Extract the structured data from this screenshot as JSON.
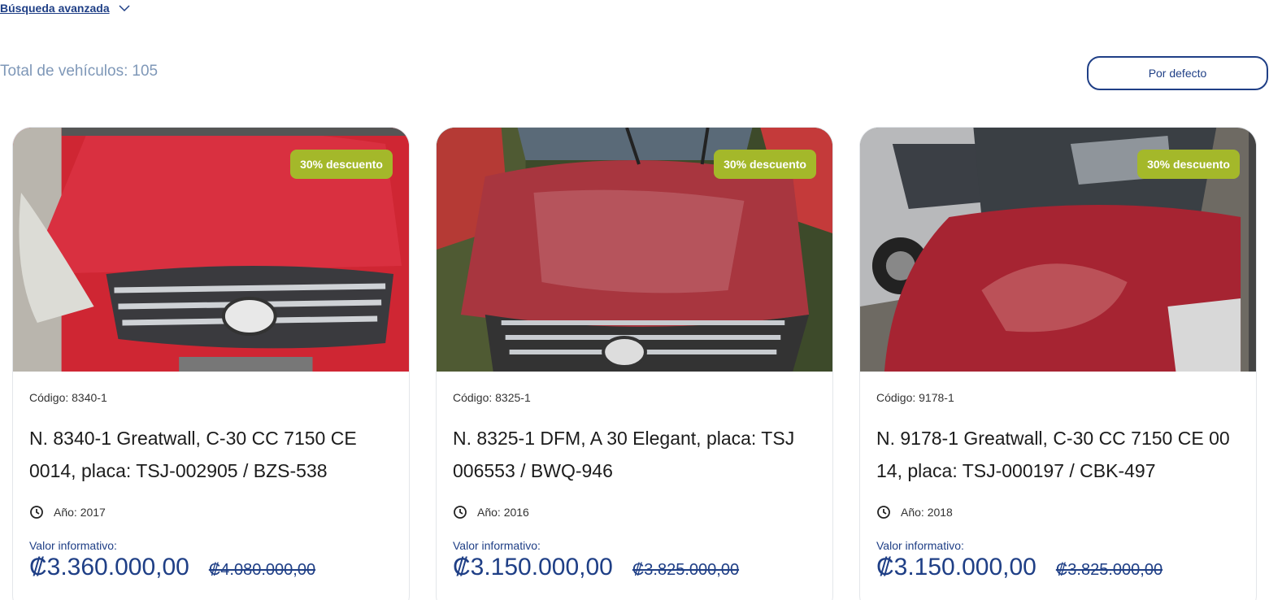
{
  "header": {
    "advanced_search": "Búsqueda avanzada",
    "total_label": "Total de vehículos:",
    "total_count": "105",
    "sort_label": "Por defecto"
  },
  "theme": {
    "primary": "#1f3f86",
    "badge": "#a4b82a",
    "muted": "#7f98b8"
  },
  "cards": [
    {
      "badge": "30% descuento",
      "code": "Código: 8340-1",
      "title": "N. 8340-1 Greatwall, C-30 CC 7150 CE 0014, placa: TSJ-002905 / BZS-538",
      "year": "Año: 2017",
      "value_label": "Valor informativo:",
      "price": "₡3.360.000,00",
      "old_price": "₡4.080.000,00",
      "image": "red-car-front-photo"
    },
    {
      "badge": "30% descuento",
      "code": "Código: 8325-1",
      "title": "N. 8325-1 DFM, A 30 Elegant, placa: TSJ 006553 / BWQ-946",
      "year": "Año: 2016",
      "value_label": "Valor informativo:",
      "price": "₡3.150.000,00",
      "old_price": "₡3.825.000,00",
      "image": "red-car-hood-photo"
    },
    {
      "badge": "30% descuento",
      "code": "Código: 9178-1",
      "title": "N. 9178-1 Greatwall, C-30 CC 7150 CE 00 14, placa: TSJ-000197 / CBK-497",
      "year": "Año: 2018",
      "value_label": "Valor informativo:",
      "price": "₡3.150.000,00",
      "old_price": "₡3.825.000,00",
      "image": "red-car-side-photo"
    }
  ]
}
